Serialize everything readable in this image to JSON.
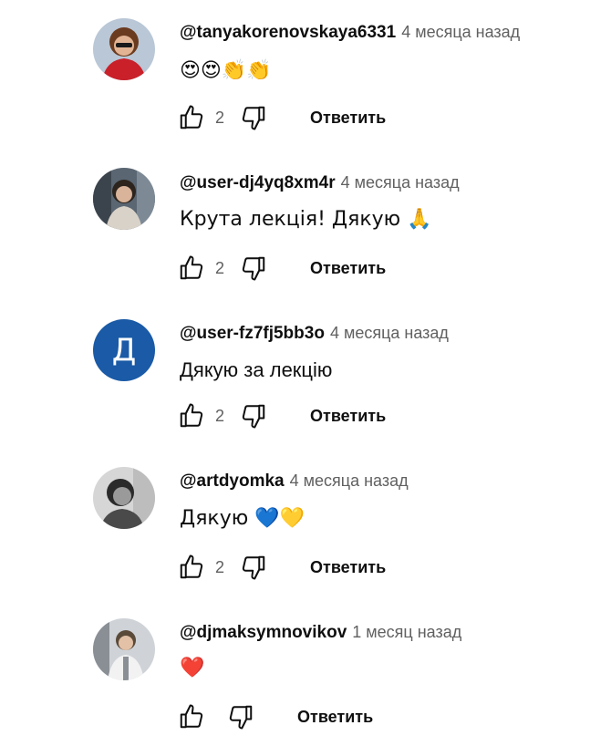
{
  "comments": [
    {
      "author": "@tanyakorenovskaya6331",
      "time": "4 месяца назад",
      "text": "😍😍👏👏",
      "likes": "2",
      "reply_label": "Ответить",
      "avatar_type": "photo",
      "colors": {
        "bg": "#b9c7d6",
        "accent": "#c9202a",
        "hair": "#6b3b1f"
      }
    },
    {
      "author": "@user-dj4yq8xm4r",
      "time": "4 месяца назад",
      "text": "Крута лекція! Дякую 🙏",
      "likes": "2",
      "reply_label": "Ответить",
      "avatar_type": "photo",
      "colors": {
        "bg": "#5a6672",
        "accent": "#d9d2c8",
        "hair": "#2d241d"
      }
    },
    {
      "author": "@user-fz7fj5bb3o",
      "time": "4 месяца назад",
      "text": "Дякую за лекцію",
      "likes": "2",
      "reply_label": "Ответить",
      "avatar_type": "letter",
      "avatar_letter": "Д",
      "colors": {
        "bg": "#1a5aa6",
        "accent": "#ffffff",
        "hair": "#ffffff"
      }
    },
    {
      "author": "@artdyomka",
      "time": "4 месяца назад",
      "text": "Дякую 💙💛",
      "likes": "2",
      "reply_label": "Ответить",
      "avatar_type": "photo",
      "colors": {
        "bg": "#d6d6d6",
        "accent": "#4a4a4a",
        "hair": "#2a2a2a"
      }
    },
    {
      "author": "@djmaksymnovikov",
      "time": "1 месяц назад",
      "text": "❤️",
      "likes": "",
      "reply_label": "Ответить",
      "avatar_type": "photo",
      "colors": {
        "bg": "#cfd3d8",
        "accent": "#8a8f96",
        "hair": "#5a4a3a"
      }
    }
  ]
}
